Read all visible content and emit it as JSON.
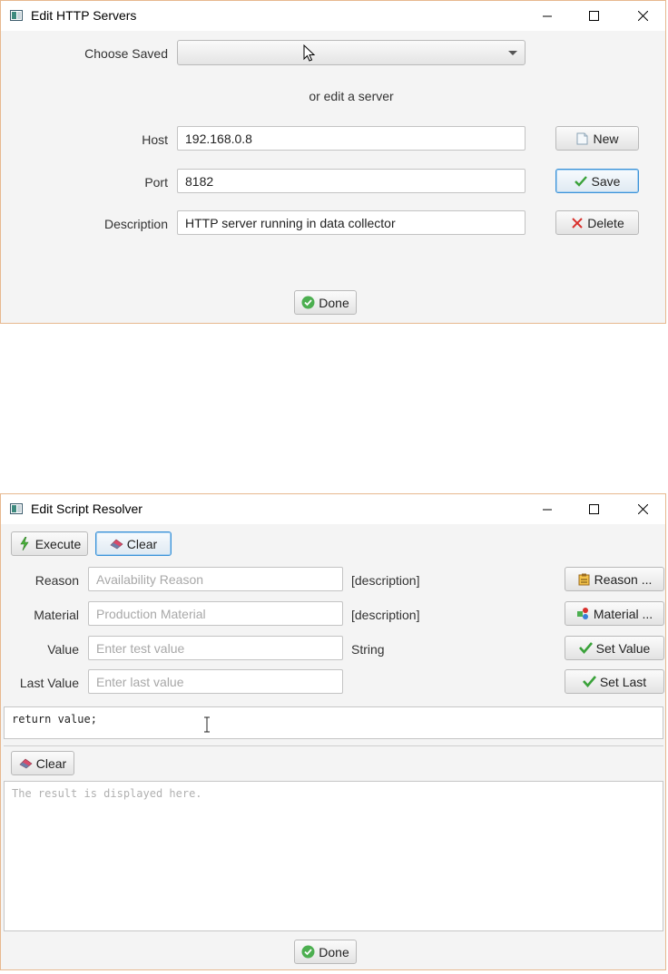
{
  "win1": {
    "title": "Edit HTTP Servers",
    "choose_saved_label": "Choose Saved",
    "choose_saved_value": "",
    "or_edit_text": "or edit a server",
    "host_label": "Host",
    "host_value": "192.168.0.8",
    "port_label": "Port",
    "port_value": "8182",
    "description_label": "Description",
    "description_value": "HTTP server running in data collector",
    "new_label": "New",
    "save_label": "Save",
    "delete_label": "Delete",
    "done_label": "Done"
  },
  "win2": {
    "title": "Edit Script Resolver",
    "execute_label": "Execute",
    "clear_label": "Clear",
    "reason_label": "Reason",
    "reason_placeholder": "Availability Reason",
    "reason_desc": "[description]",
    "reason_button": "Reason ...",
    "material_label": "Material",
    "material_placeholder": "Production Material",
    "material_desc": "[description]",
    "material_button": "Material ...",
    "value_label": "Value",
    "value_placeholder": "Enter test value",
    "value_type": "String",
    "set_value_button": "Set Value",
    "last_value_label": "Last Value",
    "last_value_placeholder": "Enter last value",
    "set_last_button": "Set Last",
    "script_text": "return value;",
    "result_clear_label": "Clear",
    "result_placeholder": "The result is displayed here.",
    "done_label": "Done"
  },
  "colors": {
    "window_border": "#e7b88f",
    "focus_blue": "#3a92d8",
    "ok_green": "#4caf50",
    "delete_red": "#d9302c"
  }
}
